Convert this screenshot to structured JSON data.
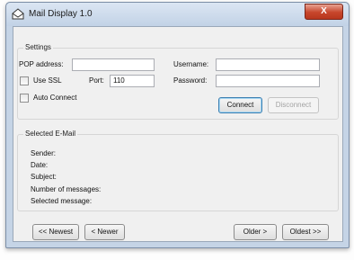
{
  "window": {
    "title": "Mail Display 1.0",
    "close_label": "X"
  },
  "settings": {
    "group_label": "Settings",
    "pop_address_label": "POP address:",
    "pop_address_value": "",
    "username_label": "Username:",
    "username_value": "",
    "use_ssl_label": "Use SSL",
    "use_ssl_checked": false,
    "port_label": "Port:",
    "port_value": "110",
    "password_label": "Password:",
    "password_value": "",
    "auto_connect_label": "Auto Connect",
    "auto_connect_checked": false,
    "connect_label": "Connect",
    "disconnect_label": "Disconnect"
  },
  "selected_email": {
    "group_label": "Selected E-Mail",
    "sender_label": "Sender:",
    "date_label": "Date:",
    "subject_label": "Subject:",
    "number_of_messages_label": "Number of messages:",
    "selected_message_label": "Selected message:"
  },
  "navigation": {
    "newest_label": "<< Newest",
    "newer_label": "< Newer",
    "older_label": "Older >",
    "oldest_label": "Oldest >>"
  }
}
